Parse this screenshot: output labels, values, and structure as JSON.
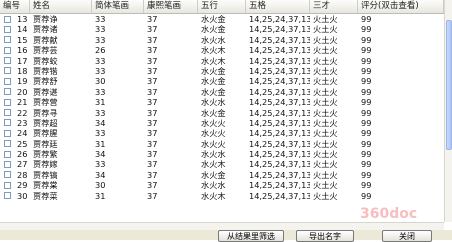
{
  "columns": [
    "编号",
    "姓名",
    "简体笔画",
    "康熙笔画",
    "五行",
    "五格",
    "三才",
    "评分(双击查看)"
  ],
  "rows": [
    [
      "13",
      "贾荐诤",
      "33",
      "37",
      "水火金",
      "14,25,24,37,13",
      "火土火",
      "99"
    ],
    [
      "14",
      "贾荐诸",
      "33",
      "37",
      "水火金",
      "14,25,24,37,13",
      "火土火",
      "99"
    ],
    [
      "15",
      "贾荐献",
      "33",
      "37",
      "水火水",
      "14,25,24,37,13",
      "火土火",
      "99"
    ],
    [
      "16",
      "贾荐芸",
      "26",
      "37",
      "水火木",
      "14,25,24,37,13",
      "火土火",
      "99"
    ],
    [
      "17",
      "贾荐蛟",
      "33",
      "37",
      "水火木",
      "14,25,24,37,13",
      "火土火",
      "99"
    ],
    [
      "18",
      "贾荐锴",
      "33",
      "37",
      "水火金",
      "14,25,24,37,13",
      "火土火",
      "99"
    ],
    [
      "19",
      "贾荐舒",
      "30",
      "37",
      "水火金",
      "14,25,24,37,13",
      "火土火",
      "99"
    ],
    [
      "20",
      "贾荐谌",
      "33",
      "37",
      "水火金",
      "14,25,24,37,13",
      "火土火",
      "99"
    ],
    [
      "21",
      "贾荐营",
      "31",
      "37",
      "水火水",
      "14,25,24,37,13",
      "火土火",
      "99"
    ],
    [
      "22",
      "贾荐寻",
      "33",
      "37",
      "水火金",
      "14,25,24,37,13",
      "火土火",
      "99"
    ],
    [
      "23",
      "贾荐超",
      "34",
      "37",
      "水火火",
      "14,25,24,37,13",
      "火土火",
      "99"
    ],
    [
      "24",
      "贾荐腥",
      "33",
      "37",
      "水火火",
      "14,25,24,37,13",
      "火土火",
      "99"
    ],
    [
      "25",
      "贾荐廷",
      "31",
      "37",
      "水火火",
      "14,25,24,37,13",
      "火土火",
      "99"
    ],
    [
      "26",
      "贾荐繁",
      "34",
      "37",
      "水火水",
      "14,25,24,37,13",
      "火土火",
      "99"
    ],
    [
      "27",
      "贾荐嫁",
      "33",
      "37",
      "水火木",
      "14,25,24,37,13",
      "火土火",
      "99"
    ],
    [
      "28",
      "贾荐镐",
      "34",
      "37",
      "水火金",
      "14,25,24,37,13",
      "火土火",
      "99"
    ],
    [
      "29",
      "贾荐棠",
      "30",
      "37",
      "水火水",
      "14,25,24,37,13",
      "火土火",
      "99"
    ],
    [
      "30",
      "贾荐菜",
      "31",
      "37",
      "水火木",
      "14,25,24,37,13",
      "火土火",
      "99"
    ]
  ],
  "buttons": {
    "filter": "从结果里筛选",
    "export": "导出名字",
    "close": "关闭"
  },
  "watermark": "360doc"
}
